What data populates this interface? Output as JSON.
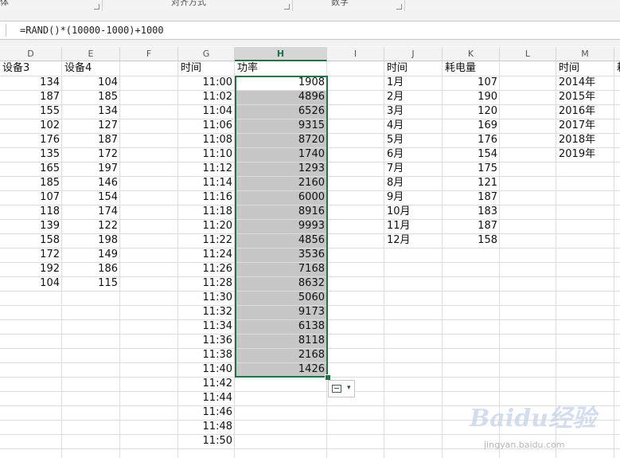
{
  "ribbon": {
    "groups": [
      {
        "label": "体"
      },
      {
        "label": "对齐方式"
      },
      {
        "label": "数字"
      }
    ]
  },
  "formula_bar": {
    "formula": "=RAND()*(10000-1000)+1000"
  },
  "columns": [
    "D",
    "E",
    "F",
    "G",
    "H",
    "I",
    "J",
    "K",
    "L",
    "M"
  ],
  "selected_column": "H",
  "sheet": {
    "headers": {
      "D": "设备3",
      "E": "设备4",
      "G": "时间",
      "H": "功率",
      "J": "时间",
      "K": "耗电量",
      "M": "时间",
      "N": "耗"
    },
    "device3": [
      "134",
      "187",
      "155",
      "102",
      "176",
      "135",
      "165",
      "185",
      "107",
      "118",
      "139",
      "158",
      "172",
      "192",
      "104"
    ],
    "device4": [
      "104",
      "185",
      "134",
      "127",
      "187",
      "172",
      "197",
      "146",
      "154",
      "174",
      "122",
      "198",
      "149",
      "186",
      "115"
    ],
    "times": [
      "11:00",
      "11:02",
      "11:04",
      "11:06",
      "11:08",
      "11:10",
      "11:12",
      "11:14",
      "11:16",
      "11:18",
      "11:20",
      "11:22",
      "11:24",
      "11:26",
      "11:28",
      "11:30",
      "11:32",
      "11:34",
      "11:36",
      "11:38",
      "11:40",
      "11:42",
      "11:44",
      "11:46",
      "11:48",
      "11:50"
    ],
    "power": [
      "1908",
      "4896",
      "6526",
      "9315",
      "8720",
      "1740",
      "1293",
      "2160",
      "6000",
      "8916",
      "9993",
      "4856",
      "3536",
      "7168",
      "8632",
      "5060",
      "9173",
      "6138",
      "8118",
      "2168",
      "1426"
    ],
    "months": [
      "1月",
      "2月",
      "3月",
      "4月",
      "5月",
      "6月",
      "7月",
      "8月",
      "9月",
      "10月",
      "11月",
      "12月"
    ],
    "consumption": [
      "107",
      "190",
      "120",
      "169",
      "176",
      "154",
      "175",
      "121",
      "187",
      "183",
      "187",
      "158"
    ],
    "years": [
      "2014年",
      "2015年",
      "2016年",
      "2017年",
      "2018年",
      "2019年"
    ]
  },
  "watermark": {
    "text": "Baidu经验",
    "sub": "jingyan.baidu.com"
  },
  "colors": {
    "accent": "#217346",
    "selection_fill": "#c6c6c6"
  }
}
